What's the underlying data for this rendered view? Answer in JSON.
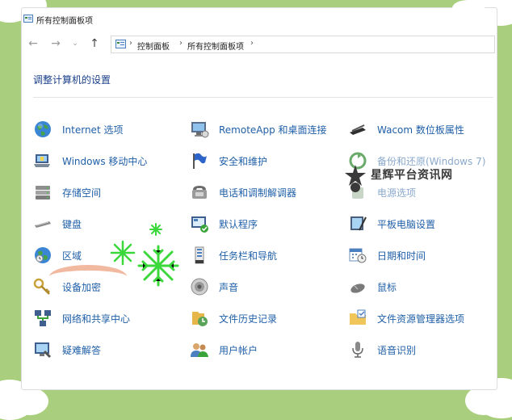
{
  "window": {
    "title": "所有控制面板项"
  },
  "address": {
    "crumbs": [
      "控制面板",
      "所有控制面板项"
    ]
  },
  "heading": "调整计算机的设置",
  "items": [
    {
      "label": "Internet 选项",
      "icon": "globe-icon"
    },
    {
      "label": "RemoteApp 和桌面连接",
      "icon": "remote-desktop-icon"
    },
    {
      "label": "Wacom 数位板属性",
      "icon": "pen-tablet-icon"
    },
    {
      "label": "Windows 移动中心",
      "icon": "mobility-center-icon"
    },
    {
      "label": "安全和维护",
      "icon": "security-flag-icon"
    },
    {
      "label": "备份和还原(Windows 7)",
      "icon": "backup-icon"
    },
    {
      "label": "存储空间",
      "icon": "storage-icon"
    },
    {
      "label": "电话和调制解调器",
      "icon": "phone-modem-icon"
    },
    {
      "label": "电源选项",
      "icon": "power-icon"
    },
    {
      "label": "键盘",
      "icon": "keyboard-icon"
    },
    {
      "label": "默认程序",
      "icon": "default-programs-icon"
    },
    {
      "label": "平板电脑设置",
      "icon": "tablet-icon"
    },
    {
      "label": "区域",
      "icon": "region-icon"
    },
    {
      "label": "任务栏和导航",
      "icon": "taskbar-icon"
    },
    {
      "label": "日期和时间",
      "icon": "calendar-clock-icon"
    },
    {
      "label": "设备加密",
      "icon": "encryption-key-icon"
    },
    {
      "label": "声音",
      "icon": "speaker-icon"
    },
    {
      "label": "鼠标",
      "icon": "mouse-icon"
    },
    {
      "label": "网络和共享中心",
      "icon": "network-icon"
    },
    {
      "label": "文件历史记录",
      "icon": "file-history-icon"
    },
    {
      "label": "文件资源管理器选项",
      "icon": "folder-options-icon"
    },
    {
      "label": "疑难解答",
      "icon": "troubleshoot-icon"
    },
    {
      "label": "用户帐户",
      "icon": "user-accounts-icon"
    },
    {
      "label": "语音识别",
      "icon": "microphone-icon"
    }
  ],
  "watermark": "星辉平台资讯网",
  "colors": {
    "link": "#1f5fa8",
    "heading": "#1a3f8a",
    "background": "#a9cf7e"
  }
}
